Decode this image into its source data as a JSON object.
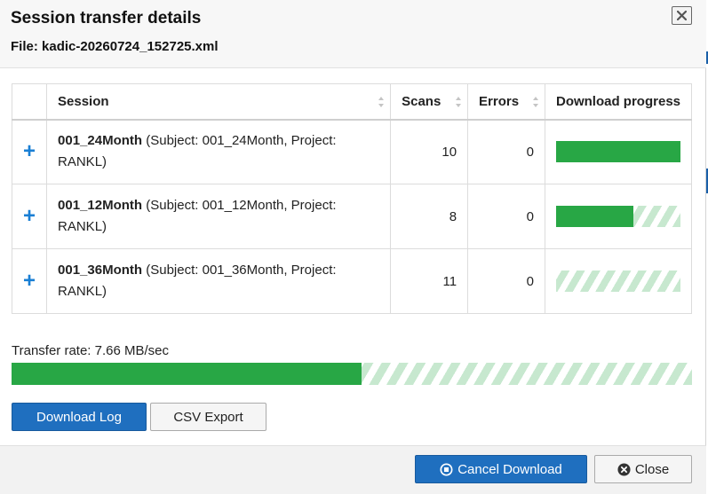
{
  "dialog": {
    "title": "Session transfer details",
    "file_label": "File:",
    "file_name": "kadic-20260724_152725.xml"
  },
  "table": {
    "headers": {
      "session": "Session",
      "scans": "Scans",
      "errors": "Errors",
      "progress": "Download progress"
    },
    "rows": [
      {
        "session_id": "001_24Month",
        "details": "(Subject: 001_24Month, Project: RANKL)",
        "scans": "10",
        "errors": "0",
        "progress": 1.0
      },
      {
        "session_id": "001_12Month",
        "details": "(Subject: 001_12Month, Project: RANKL)",
        "scans": "8",
        "errors": "0",
        "progress": 0.62
      },
      {
        "session_id": "001_36Month",
        "details": "(Subject: 001_36Month, Project: RANKL)",
        "scans": "11",
        "errors": "0",
        "progress": 0.0
      }
    ],
    "expand_symbol": "+"
  },
  "transfer": {
    "rate_text": "Transfer rate: 7.66 MB/sec",
    "overall_progress": 0.515
  },
  "buttons": {
    "download_log": "Download Log",
    "csv_export": "CSV Export",
    "cancel_download": "Cancel Download",
    "close": "Close"
  },
  "colors": {
    "primary": "#1f6fbf",
    "progress_fill": "#28a745",
    "progress_stripe": "#c7e8cf",
    "expand_icon": "#1a7fd4"
  },
  "icons": {
    "dismiss": "close-x-icon",
    "expand": "plus-icon",
    "sort": "sort-arrows-icon",
    "cancel": "stop-circle-icon",
    "close": "times-circle-icon"
  }
}
